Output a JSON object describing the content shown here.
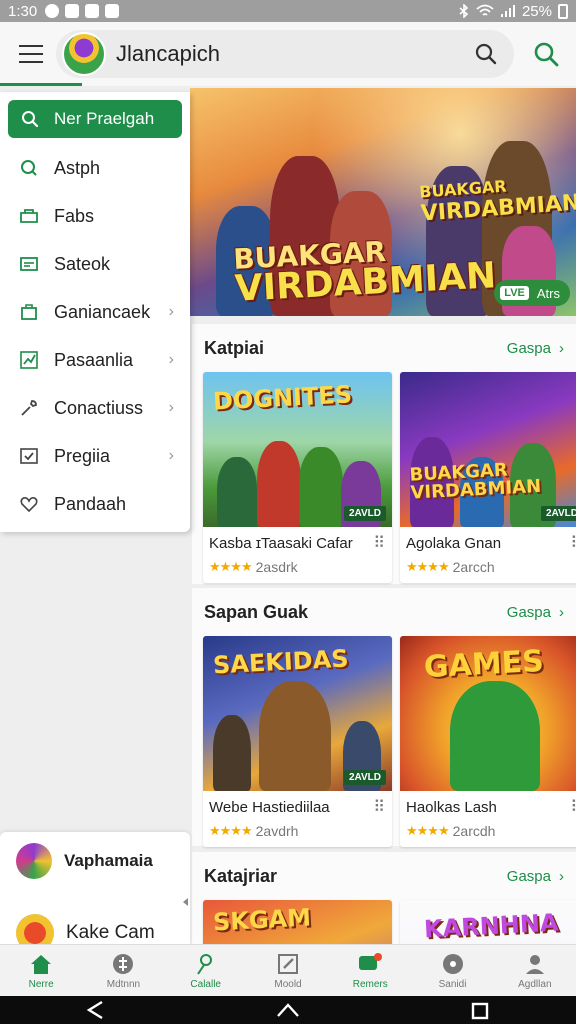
{
  "status_bar": {
    "time": "1:30",
    "battery": "25%"
  },
  "app_bar": {
    "title": "Jlancapich"
  },
  "drawer": {
    "search_label": "Ner Praelgah",
    "items": [
      {
        "label": "Astph",
        "icon": "search-icon",
        "has_chevron": false
      },
      {
        "label": "Fabs",
        "icon": "folder-icon",
        "has_chevron": false
      },
      {
        "label": "Sateok",
        "icon": "card-icon",
        "has_chevron": false
      },
      {
        "label": "Ganiancaek",
        "icon": "bag-icon",
        "has_chevron": true
      },
      {
        "label": "Pasaanlia",
        "icon": "chart-icon",
        "has_chevron": true
      },
      {
        "label": "Conactiuss",
        "icon": "tool-icon",
        "has_chevron": true
      },
      {
        "label": "Pregiia",
        "icon": "checkbox-icon",
        "has_chevron": true
      },
      {
        "label": "Pandaah",
        "icon": "heart-icon",
        "has_chevron": false
      }
    ]
  },
  "hero": {
    "title_line1": "BUAKGAR",
    "title_line2": "VIRDABMIAN",
    "title2_line1": "BUAKGAR",
    "title2_line2": "VIRDABMIAN",
    "live_tag": "LVE",
    "live_text": "Atrs"
  },
  "sections": [
    {
      "title": "Katpiai",
      "more": "Gaspa",
      "cards": [
        {
          "art_text": "DOGNITES",
          "corner": "2AVLD",
          "name": "Kasba ɪTaasaki Cafar",
          "rating": "2asdrk"
        },
        {
          "art_text": "BUAKGAR VIRDABMIAN",
          "corner": "2AVLD",
          "name": "Agolaka Gnan",
          "rating": "2arcch"
        }
      ]
    },
    {
      "title": "Sapan Guak",
      "more": "Gaspa",
      "cards": [
        {
          "art_text": "SAEKIDAS",
          "corner": "2AVLD",
          "name": "Webe Hastiediilaa",
          "rating": "2avdrh"
        },
        {
          "art_text": "GAMES",
          "corner": "",
          "name": "Haolkas Lash",
          "rating": "2arcdh"
        }
      ]
    },
    {
      "title": "Katajriar",
      "more": "Gaspa",
      "cards": [
        {
          "art_text": "SKGAM",
          "corner": "",
          "name": "",
          "rating": ""
        },
        {
          "art_text": "KARNHNA",
          "corner": "",
          "name": "",
          "rating": ""
        }
      ]
    }
  ],
  "profile": {
    "name": "Vaphamaia",
    "second": "Kake Cam"
  },
  "bottom_nav": [
    {
      "label": "Nerre",
      "icon": "home-icon",
      "active": true
    },
    {
      "label": "Mdtnnn",
      "icon": "compass-icon",
      "active": false
    },
    {
      "label": "Calalle",
      "icon": "person-icon",
      "active": false
    },
    {
      "label": "Moold",
      "icon": "edit-icon",
      "active": false
    },
    {
      "label": "Remers",
      "icon": "chat-icon",
      "active": false
    },
    {
      "label": "Sanidi",
      "icon": "circle-icon",
      "active": false
    },
    {
      "label": "Agdllan",
      "icon": "account-icon",
      "active": false
    }
  ],
  "colors": {
    "accent": "#1e8e4a",
    "star": "#f2a900"
  }
}
